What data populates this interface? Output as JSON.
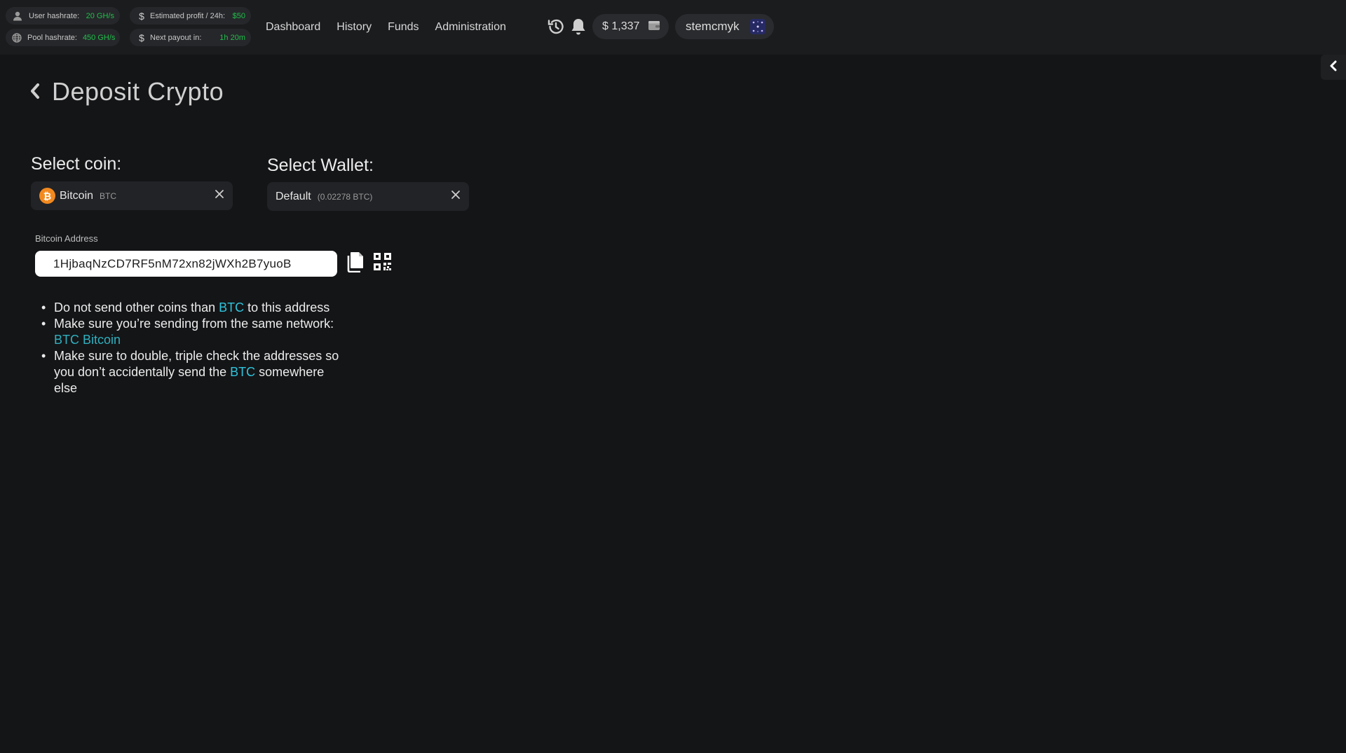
{
  "topbar": {
    "stats": [
      {
        "label": "User hashrate:",
        "value": "20 GH/s",
        "icon": "user-icon"
      },
      {
        "label": "Estimated profit / 24h:",
        "value": "$50",
        "icon": "dollar-icon"
      },
      {
        "label": "Pool hashrate:",
        "value": "450 GH/s",
        "icon": "globe-icon"
      },
      {
        "label": "Next payout in:",
        "value": "1h 20m",
        "icon": "dollar-icon"
      }
    ],
    "nav": [
      "Dashboard",
      "History",
      "Funds",
      "Administration"
    ],
    "balance": "$ 1,337",
    "username": "stemcmyk",
    "accent_green": "#1fbf4a"
  },
  "page": {
    "title": "Deposit Crypto",
    "select_coin_label": "Select coin:",
    "select_wallet_label": "Select Wallet:",
    "coin": {
      "name": "Bitcoin",
      "ticker": "BTC",
      "color": "#f2891f"
    },
    "wallet": {
      "name": "Default",
      "balance": "(0.02278 BTC)"
    },
    "address_label": "Bitcoin Address",
    "address": "1HjbaqNzCD7RF5nM72xn82jWXh2B7yuoB",
    "notes": {
      "n1_a": "Do not send other coins than ",
      "n1_hl": "BTC",
      "n1_b": " to this address",
      "n2_a": "Make sure you’re sending from the same network: ",
      "n2_hl": "BTC Bitcoin",
      "n3_a": "Make sure to double, triple check the addresses so you don’t accidentally send the ",
      "n3_hl": "BTC",
      "n3_b": " somewhere else"
    },
    "highlight_color": "#2fc4dc"
  }
}
